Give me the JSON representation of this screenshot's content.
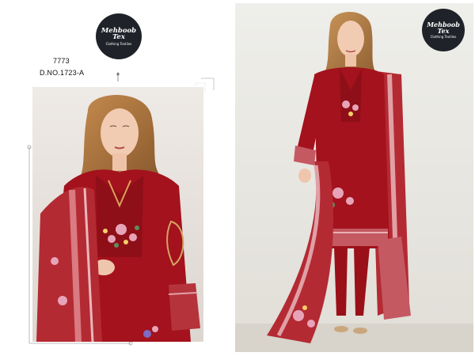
{
  "left_panel": {
    "design_number": "7773",
    "design_code": "D.NO.1723-A",
    "image_alt": "model-closeup"
  },
  "right_panel": {
    "image_alt": "model-full-length"
  },
  "logos": [
    {
      "brand": "Mehboob Tex",
      "subtitle": "Clothing Textiles"
    },
    {
      "brand": "Mehboob Tex",
      "subtitle": "Clothing Textiles"
    }
  ],
  "colors": {
    "dress": "#a3121d",
    "dupatta_border": "#c44a52",
    "background_left": "#e9e5e1",
    "background_right": "#ecebe6",
    "logo": "#1f2228"
  }
}
